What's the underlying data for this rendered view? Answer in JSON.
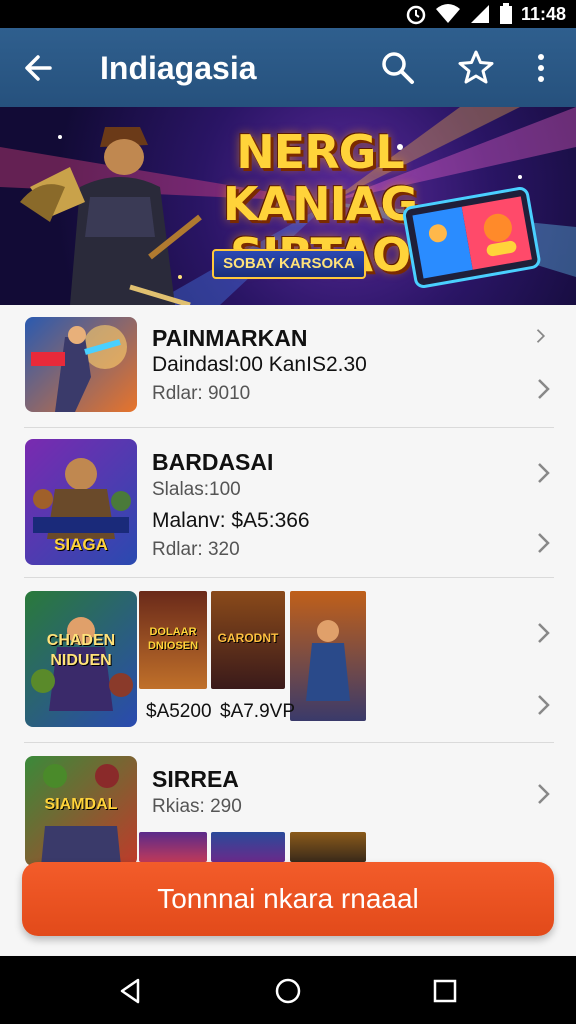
{
  "status": {
    "time": "11:48"
  },
  "appbar": {
    "title": "Indiagasia"
  },
  "banner": {
    "title_line1": "NERGL KANIAG",
    "title_line2": "SIRTAO",
    "tag": "SOBAY KARSOKA"
  },
  "items": [
    {
      "title": "PAINMARKAN",
      "line": "Daindasl:00 KanIS2.30",
      "meta": "Rdlar: 9010"
    },
    {
      "title": "BARDASAI",
      "meta1": "Slalas:100",
      "line": "Malanv: $A5:366",
      "meta2": "Rdlar: 320",
      "thumb_text": "SIAGA"
    },
    {
      "thumb_text": "CHADEN NIDUEN",
      "card1": "DOLAAR DNIOSEN",
      "card2": "GARODNT",
      "price1": "$A5200",
      "price2": "$A7.9VP"
    },
    {
      "title": "SIRREA",
      "meta": "Rkias: 290",
      "thumb_text": "SIAMDAL"
    }
  ],
  "cta": {
    "label": "Tonnnai nkara rnaaal"
  },
  "colors": {
    "appbar": "#2f5f8e",
    "cta": "#f35c2a",
    "banner_title": "#ffd33a"
  }
}
